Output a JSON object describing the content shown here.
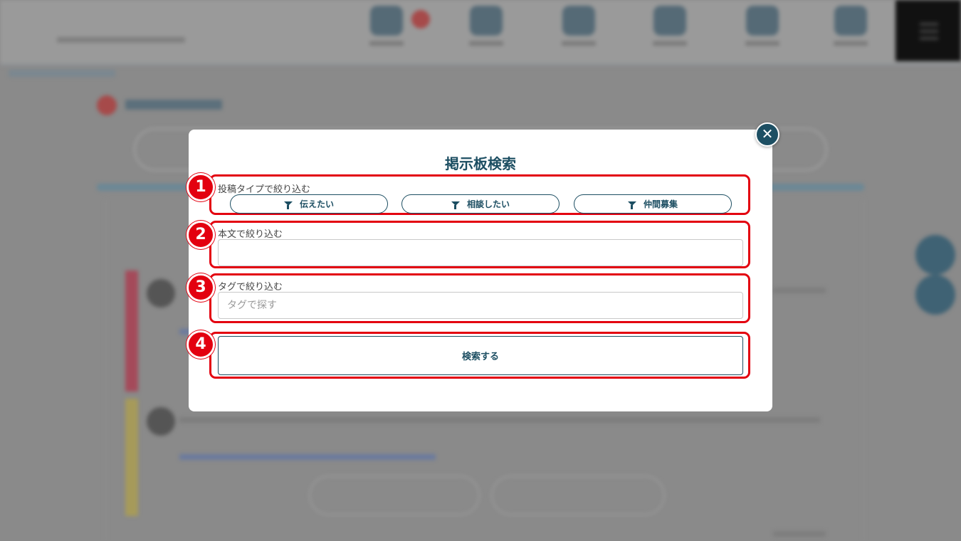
{
  "modal": {
    "title": "掲示板検索",
    "close_icon": "close-icon"
  },
  "post_type": {
    "number": "1",
    "label": "投稿タイプで絞り込む",
    "buttons": [
      {
        "label": "伝えたい",
        "icon": "filter-icon"
      },
      {
        "label": "相談したい",
        "icon": "filter-icon"
      },
      {
        "label": "仲間募集",
        "icon": "filter-icon"
      }
    ]
  },
  "body_text": {
    "number": "2",
    "label": "本文で絞り込む",
    "value": "",
    "placeholder": ""
  },
  "tag": {
    "number": "3",
    "label": "タグで絞り込む",
    "value": "",
    "placeholder": "タグで探す"
  },
  "search": {
    "number": "4",
    "label": "検索する"
  },
  "colors": {
    "accent": "#1c4e62",
    "highlight": "#e3000f",
    "overlay": "#8a8a8a"
  }
}
